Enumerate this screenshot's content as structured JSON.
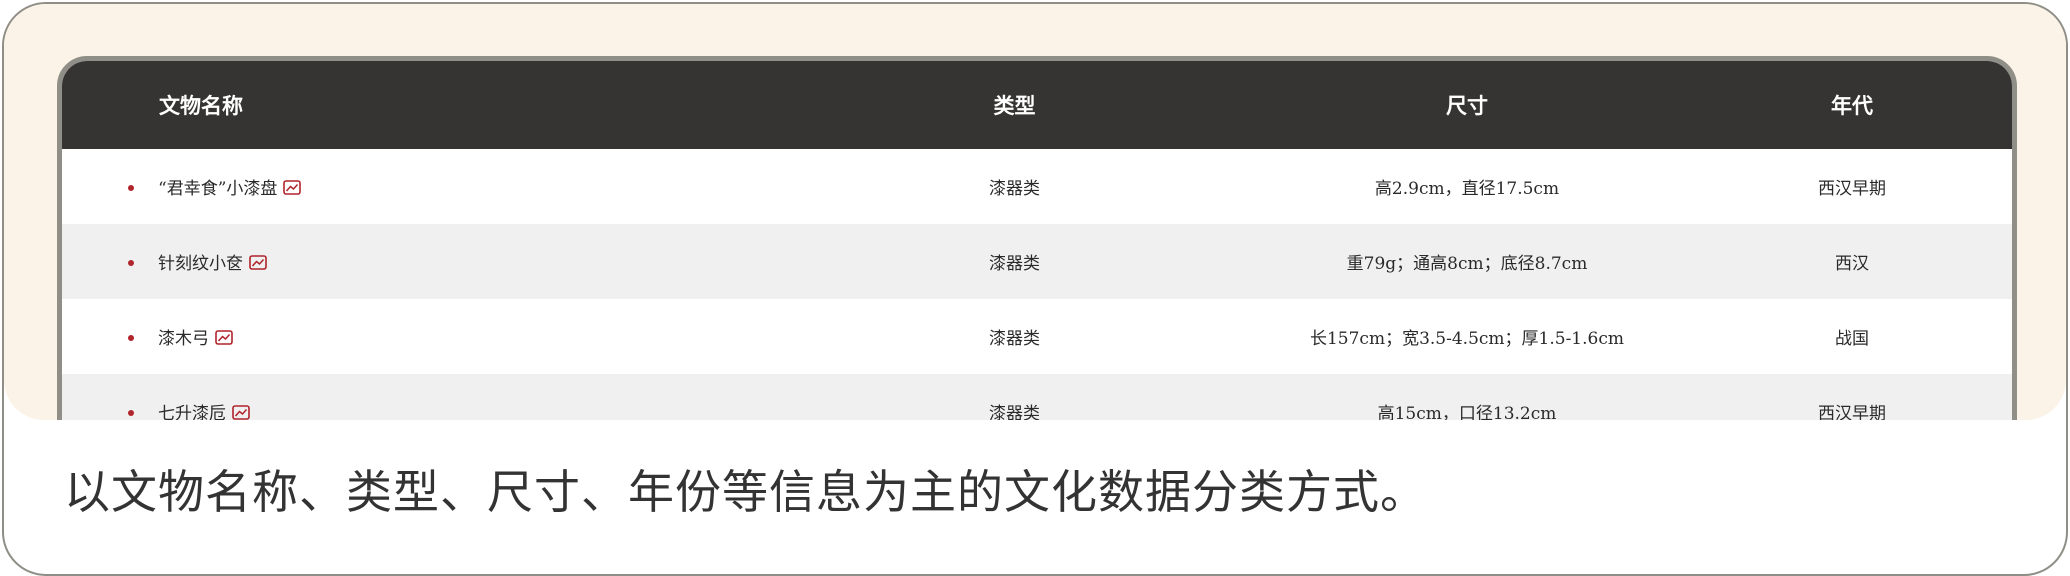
{
  "table": {
    "headers": {
      "name": "文物名称",
      "type": "类型",
      "size": "尺寸",
      "era": "年代"
    },
    "rows": [
      {
        "name": "“君幸食”小漆盘",
        "type": "漆器类",
        "size": "高2.9cm，直径17.5cm",
        "era": "西汉早期"
      },
      {
        "name": "针刻纹小奁",
        "type": "漆器类",
        "size": "重79g；通高8cm；底径8.7cm",
        "era": "西汉"
      },
      {
        "name": "漆木弓",
        "type": "漆器类",
        "size": "长157cm；宽3.5-4.5cm；厚1.5-1.6cm",
        "era": "战国"
      },
      {
        "name": "七升漆卮",
        "type": "漆器类",
        "size": "高15cm，口径13.2cm",
        "era": "西汉早期"
      }
    ],
    "row_icon": "image-icon",
    "bullet_color": "#b0242b",
    "header_bg": "#353432"
  },
  "caption": "以文物名称、类型、尺寸、年份等信息为主的文化数据分类方式。",
  "colors": {
    "hero_bg": "#fcf3e8",
    "accent": "#b0242b"
  }
}
